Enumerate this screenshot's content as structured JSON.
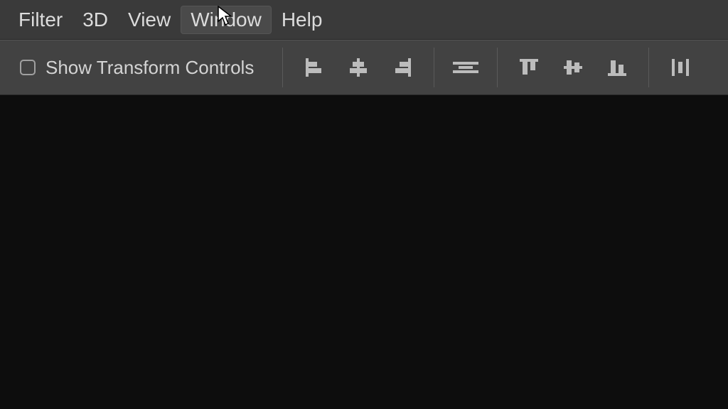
{
  "menubar": {
    "items": [
      "Filter",
      "3D",
      "View",
      "Window",
      "Help"
    ],
    "hovered_index": 3
  },
  "options": {
    "show_transform_label": "Show Transform Controls",
    "show_transform_checked": false
  },
  "icons": {
    "group1": [
      "align-left-edges",
      "align-horizontal-centers",
      "align-right-edges"
    ],
    "group2": [
      "align-center-horizontal"
    ],
    "group3": [
      "align-top-edges",
      "align-vertical-centers",
      "align-bottom-edges"
    ],
    "group4": [
      "distribute-vertical"
    ]
  },
  "colors": {
    "icon": "#bcbcbc"
  }
}
